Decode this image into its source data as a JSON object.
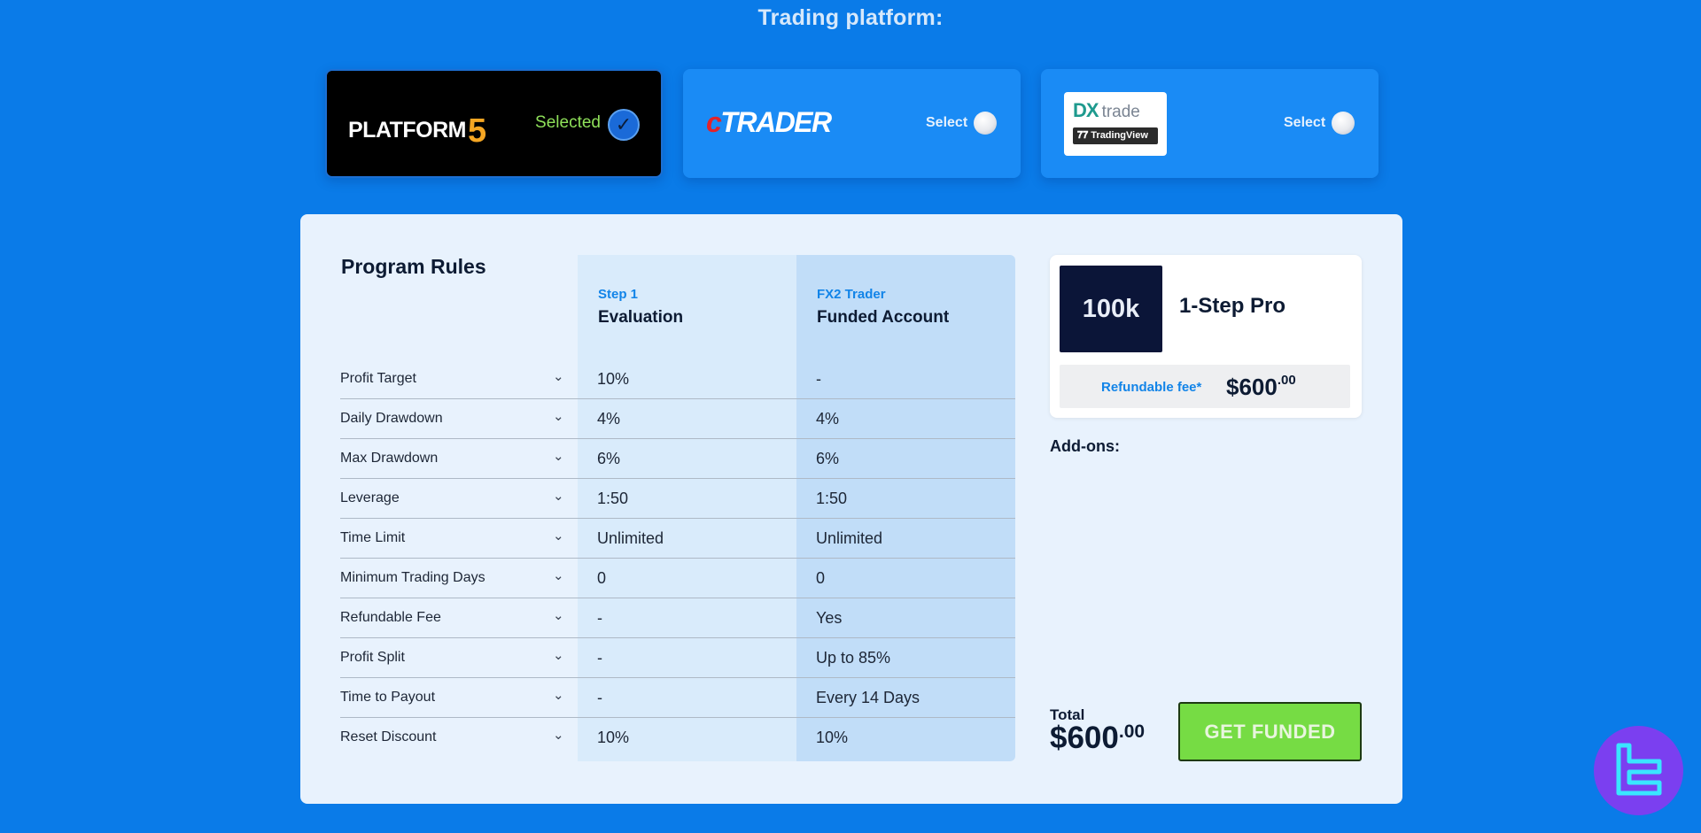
{
  "header": {
    "title": "Trading platform:"
  },
  "platforms": [
    {
      "name": "PLATFORM",
      "number": "5",
      "select_label": "Selected"
    },
    {
      "prefix": "c",
      "name": "TRADER",
      "select_label": "Select"
    },
    {
      "mark": "DX",
      "name": "trade",
      "sub": "TradingView",
      "select_label": "Select"
    }
  ],
  "rules": {
    "title": "Program Rules",
    "columns": [
      {
        "sub": "Step 1",
        "main": "Evaluation"
      },
      {
        "sub": "FX2 Trader",
        "main": "Funded Account"
      }
    ],
    "rows": [
      {
        "label": "Profit Target",
        "v1": "10%",
        "v2": "-"
      },
      {
        "label": "Daily Drawdown",
        "v1": "4%",
        "v2": "4%"
      },
      {
        "label": "Max Drawdown",
        "v1": "6%",
        "v2": "6%"
      },
      {
        "label": "Leverage",
        "v1": "1:50",
        "v2": "1:50"
      },
      {
        "label": "Time Limit",
        "v1": "Unlimited",
        "v2": "Unlimited"
      },
      {
        "label": "Minimum Trading Days",
        "v1": "0",
        "v2": "0"
      },
      {
        "label": "Refundable Fee",
        "v1": "-",
        "v2": "Yes"
      },
      {
        "label": "Profit Split",
        "v1": "-",
        "v2": "Up to 85%"
      },
      {
        "label": "Time to Payout",
        "v1": "-",
        "v2": "Every 14 Days"
      },
      {
        "label": "Reset Discount",
        "v1": "10%",
        "v2": "10%"
      }
    ]
  },
  "summary": {
    "account_size": "100k",
    "plan_name": "1-Step Pro",
    "fee_label": "Refundable fee*",
    "fee_main": "$600",
    "fee_cents": ".00",
    "addons_label": "Add-ons:",
    "total_label": "Total",
    "total_main": "$600",
    "total_cents": ".00",
    "cta_label": "GET FUNDED"
  },
  "colors": {
    "background": "#0a7be8",
    "accent": "#1284e8",
    "cta": "#76dc44",
    "selected": "#8fe15a"
  }
}
